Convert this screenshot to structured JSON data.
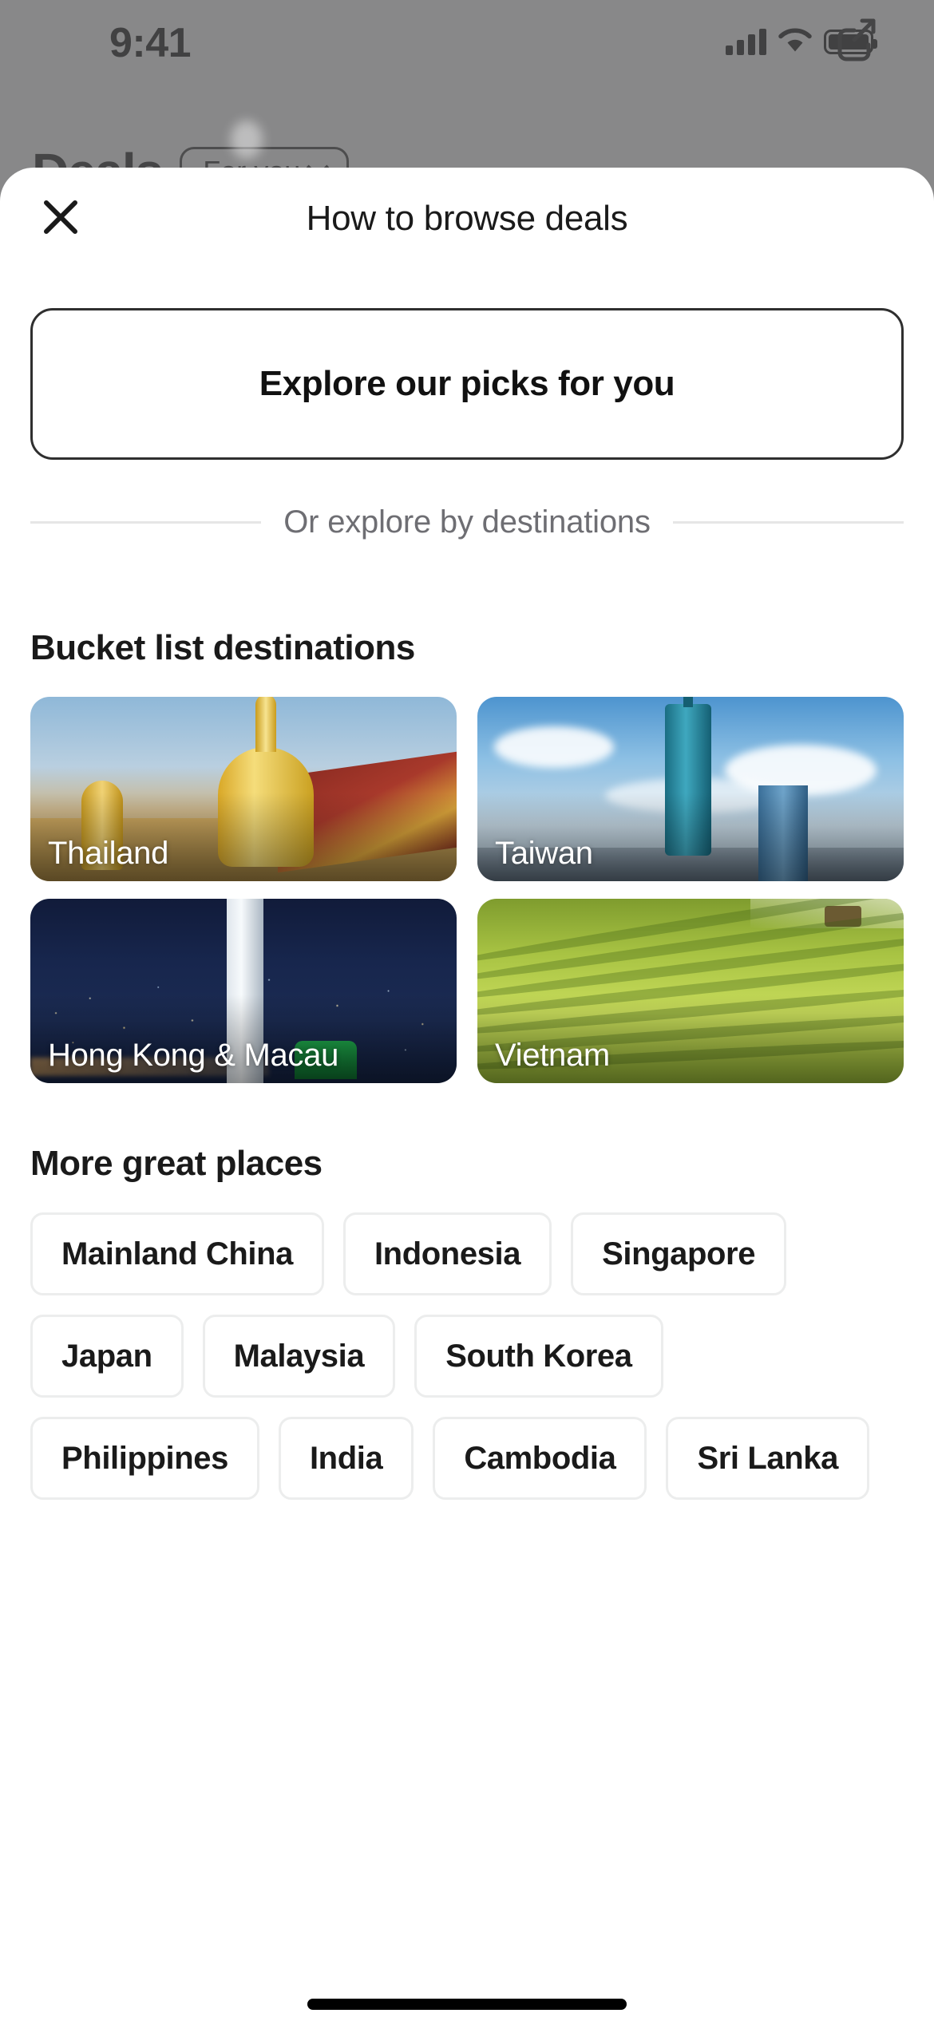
{
  "status_bar": {
    "time": "9:41",
    "icons": [
      "cellular-signal-icon",
      "wifi-icon",
      "battery-icon"
    ]
  },
  "background_app": {
    "title": "Deals",
    "filter_pill": {
      "label": "For you",
      "icon": "chevron-down-icon"
    },
    "share_icon": "share-external-icon"
  },
  "sheet": {
    "close_icon": "close-icon",
    "title": "How to browse deals",
    "primary_cta": "Explore our picks for you",
    "divider_label": "Or explore by destinations",
    "bucket_section": {
      "title": "Bucket list destinations",
      "cards": [
        {
          "label": "Thailand",
          "photo": "golden-thai-temple"
        },
        {
          "label": "Taiwan",
          "photo": "taipei-101-skyline"
        },
        {
          "label": "Hong Kong & Macau",
          "photo": "hong-kong-night-skyline"
        },
        {
          "label": "Vietnam",
          "photo": "green-rice-terraces"
        }
      ]
    },
    "more_section": {
      "title": "More great places",
      "chips": [
        "Mainland China",
        "Indonesia",
        "Singapore",
        "Japan",
        "Malaysia",
        "South Korea",
        "Philippines",
        "India",
        "Cambodia",
        "Sri Lanka"
      ]
    }
  },
  "colors": {
    "sheet_background": "#ffffff",
    "dim_overlay": "#5a5a5c",
    "text_primary": "#1a1a1a",
    "text_secondary": "#6e6e73",
    "border_strong": "#2f2f2f",
    "border_light": "#eceded",
    "home_indicator": "#000000"
  }
}
